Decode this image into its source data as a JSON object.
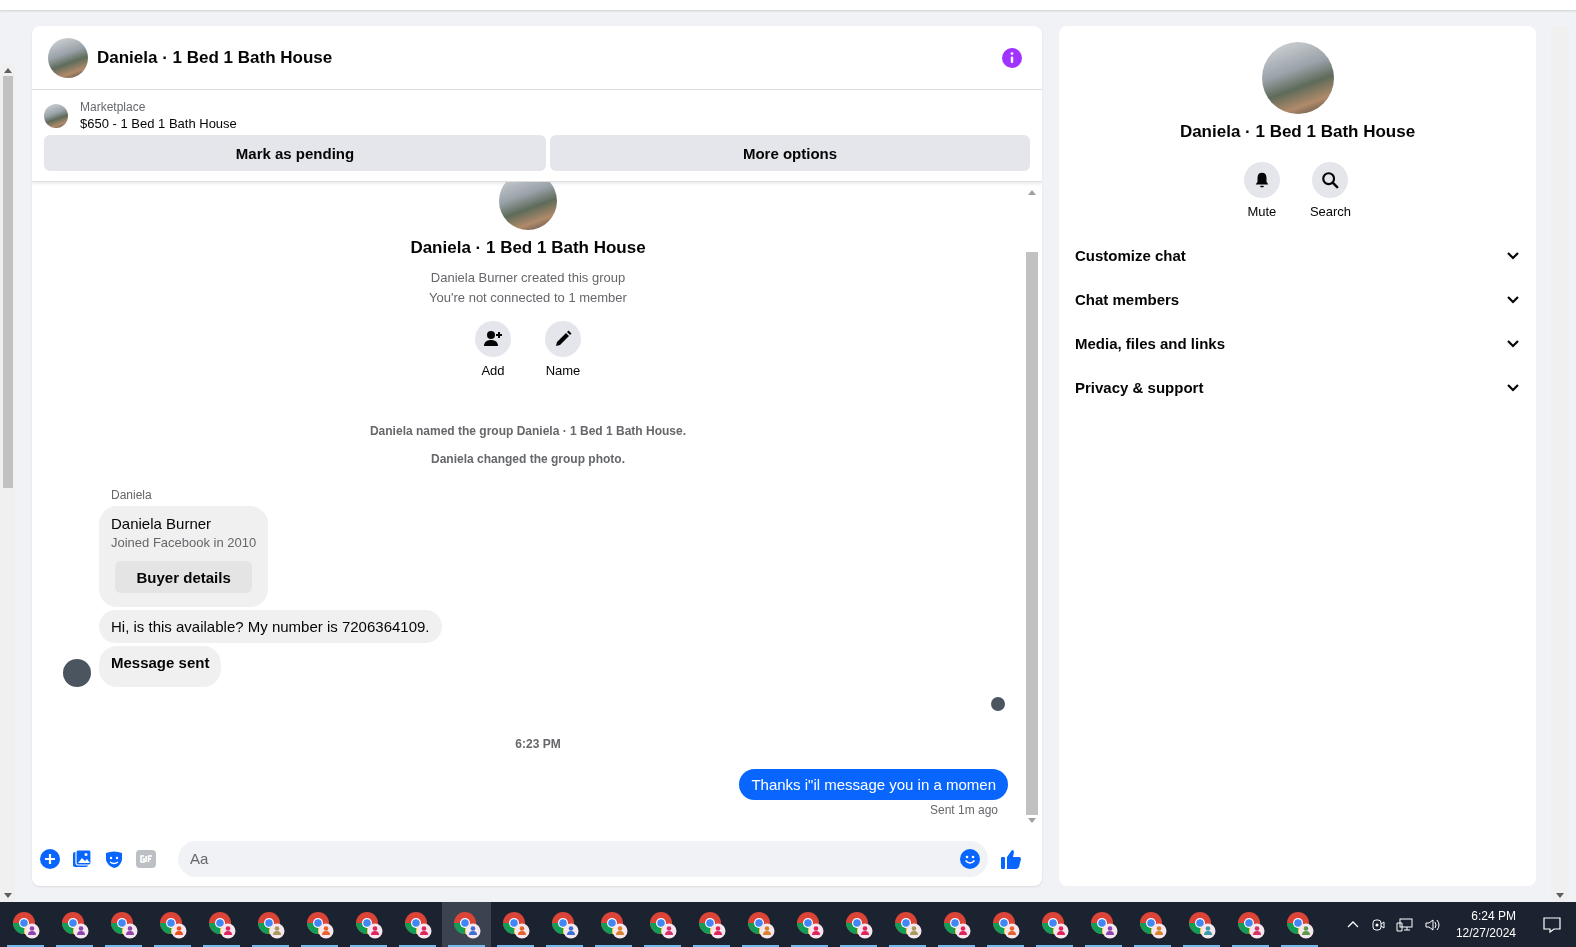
{
  "chat": {
    "title": "Daniela · 1 Bed 1 Bath House",
    "listing": {
      "source": "Marketplace",
      "title": "$650 - 1 Bed 1 Bath House"
    },
    "actions": [
      "Mark as pending",
      "More options"
    ],
    "intro": {
      "title": "Daniela · 1 Bed 1 Bath House",
      "lines": [
        "Daniela Burner created this group",
        "You're not connected to 1 member"
      ],
      "buttons": [
        {
          "kind": "add",
          "label": "Add"
        },
        {
          "kind": "name",
          "label": "Name"
        }
      ]
    },
    "events": [
      "Daniela named the group Daniela · 1 Bed 1 Bath House.",
      "Daniela changed the group photo."
    ],
    "sender_label": "Daniela",
    "buyer_card": {
      "name": "Daniela Burner",
      "joined": "Joined Facebook in 2010",
      "button": "Buyer details"
    },
    "incoming": [
      "Hi, is this available? My number is 7206364109.",
      "Message sent"
    ],
    "timestamp": "6:23 PM",
    "outgoing": {
      "text": "Thanks i\"il message you in a momen",
      "status": "Sent 1m ago"
    },
    "composer": {
      "placeholder": "Aa"
    }
  },
  "details": {
    "title": "Daniela · 1 Bed 1 Bath House",
    "actions": [
      {
        "kind": "mute",
        "label": "Mute"
      },
      {
        "kind": "search",
        "label": "Search"
      }
    ],
    "sections": [
      {
        "label": "Customize chat",
        "expanded": false
      },
      {
        "label": "Chat members",
        "expanded": false
      },
      {
        "label": "Media, files and links",
        "expanded": false
      },
      {
        "label": "Privacy & support",
        "expanded": false
      }
    ]
  },
  "taskbar": {
    "apps": [
      {
        "color": "#8e44ad",
        "selected": false
      },
      {
        "color": "#8e44ad",
        "selected": false
      },
      {
        "color": "#8e44ad",
        "selected": false
      },
      {
        "color": "#e8501e",
        "selected": false
      },
      {
        "color": "#e0245e",
        "selected": false
      },
      {
        "color": "#a89a5a",
        "selected": false
      },
      {
        "color": "#e8632a",
        "selected": false
      },
      {
        "color": "#e0245e",
        "selected": false
      },
      {
        "color": "#e0245e",
        "selected": false
      },
      {
        "color": "#3b6fd4",
        "selected": true
      },
      {
        "color": "#e8632a",
        "selected": false
      },
      {
        "color": "#3b6fd4",
        "selected": false
      },
      {
        "color": "#d9822b",
        "selected": false
      },
      {
        "color": "#d6336c",
        "selected": false
      },
      {
        "color": "#e0245e",
        "selected": false
      },
      {
        "color": "#d9822b",
        "selected": false
      },
      {
        "color": "#e0245e",
        "selected": false
      },
      {
        "color": "#e0245e",
        "selected": false
      },
      {
        "color": "#a89a5a",
        "selected": false
      },
      {
        "color": "#e0245e",
        "selected": false
      },
      {
        "color": "#e8632a",
        "selected": false
      },
      {
        "color": "#e0245e",
        "selected": false
      },
      {
        "color": "#8e44ad",
        "selected": false
      },
      {
        "color": "#d9822b",
        "selected": false
      },
      {
        "color": "#3a9aa8",
        "selected": false
      },
      {
        "color": "#d6336c",
        "selected": false
      },
      {
        "color": "#5a9a4a",
        "selected": false
      }
    ],
    "time": "6:24 PM",
    "date": "12/27/2024"
  }
}
